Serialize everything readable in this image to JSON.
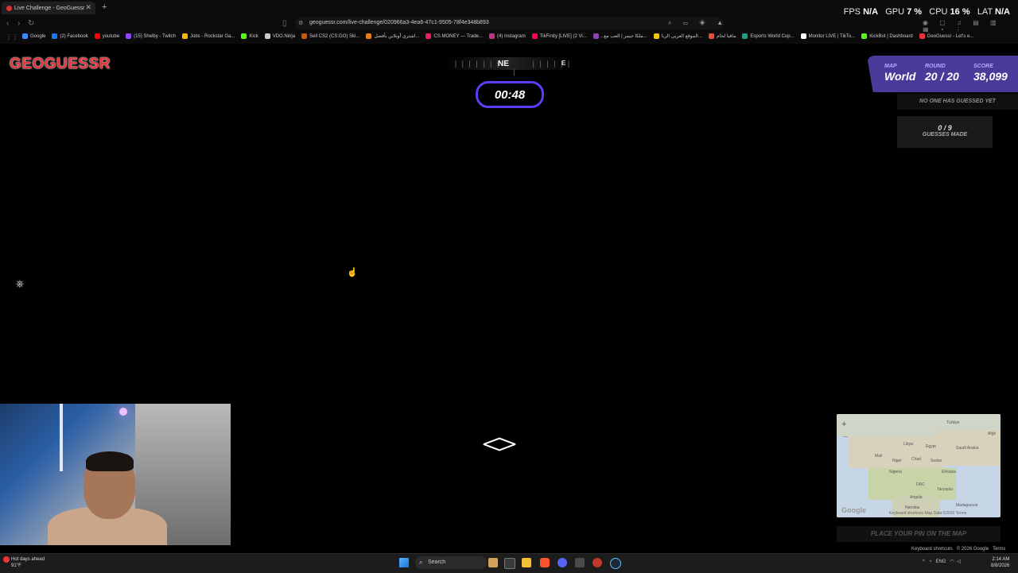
{
  "browser": {
    "tab_title": "Live Challenge - GeoGuessr",
    "url": "geoguessr.com/live-challenge/020966a3-4ea6-47c1-9505-78f4e348b893",
    "bookmarks": [
      {
        "label": "Google",
        "color": "#4285f4"
      },
      {
        "label": "(2) Facebook",
        "color": "#1877f2"
      },
      {
        "label": "youtube",
        "color": "#ff0000"
      },
      {
        "label": "(15) Shelby - Twitch",
        "color": "#9146ff"
      },
      {
        "label": "Jobs - Rockstar Ga...",
        "color": "#f5b800"
      },
      {
        "label": "Kick",
        "color": "#53fc18"
      },
      {
        "label": "VDO.Ninja",
        "color": "#cccccc"
      },
      {
        "label": "Sell CS2 (CS:GO) Ski...",
        "color": "#d35400"
      },
      {
        "label": "اشتري أونلاين بأفضل...",
        "color": "#e67e22"
      },
      {
        "label": "CS.MONEY — Trade...",
        "color": "#e91e63"
      },
      {
        "label": "(4) Instagram",
        "color": "#c13584"
      },
      {
        "label": "TikFinity [LIVE] (2 Vi...",
        "color": "#ff0050"
      },
      {
        "label": "ملكا جيمز | العب مع ـ...",
        "color": "#8e44ad"
      },
      {
        "label": "الموقع العربي الريا...",
        "color": "#f1c40f"
      },
      {
        "label": "مافيا لحام",
        "color": "#e74c3c"
      },
      {
        "label": "Esports World Cup...",
        "color": "#16a085"
      },
      {
        "label": "Monitor LIVE | TikTo...",
        "color": "#ffffff"
      },
      {
        "label": "KickBot | Dashboard",
        "color": "#53fc18"
      },
      {
        "label": "GeoGuessr - Let's e...",
        "color": "#e8323a"
      }
    ]
  },
  "perf": {
    "fps_label": "FPS",
    "fps": "N/A",
    "gpu_label": "GPU",
    "gpu": "7 %",
    "cpu_label": "CPU",
    "cpu": "16 %",
    "lat_label": "LAT",
    "lat": "N/A"
  },
  "game": {
    "logo": "GEOGUESSR",
    "compass_heading": "NE",
    "compass_next": "E",
    "timer": "00:48",
    "hud": {
      "map_label": "MAP",
      "map_value": "World",
      "round_label": "ROUND",
      "round_value": "20 / 20",
      "score_label": "SCORE",
      "score_value": "38,099"
    },
    "guess_status": "NO ONE HAS GUESSED YET",
    "guesses_count": "0 / 9",
    "guesses_label": "GUESSES MADE",
    "place_pin": "PLACE YOUR PIN ON THE MAP",
    "footer_shortcuts": "Keyboard shortcuts",
    "footer_copyright": "© 2026 Google",
    "footer_terms": "Terms",
    "map_logo": "Google",
    "map_attr": "Keyboard shortcuts   Map Data ©2026   Terms",
    "map_labels": [
      "Türkiye",
      "Afgh",
      "Libya",
      "Egypt",
      "Saudi Arabia",
      "Mali",
      "Niger",
      "Chad",
      "Sudan",
      "Nigeria",
      "Ethiopia",
      "DRC",
      "Tanzania",
      "Angola",
      "Namibia",
      "Madagascar"
    ]
  },
  "taskbar": {
    "weather_title": "Hot days ahead",
    "weather_temp": "91°F",
    "search_placeholder": "Search",
    "lang": "ENG",
    "time": "2:14 AM",
    "date": "8/8/2026"
  }
}
